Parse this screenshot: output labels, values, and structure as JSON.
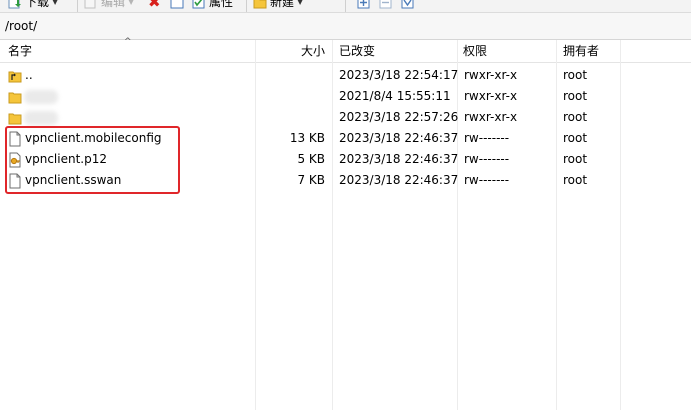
{
  "toolbar": {
    "download_label": "下载",
    "edit_label": "编辑",
    "properties_label": "属性",
    "new_label": "新建"
  },
  "path": "/root/",
  "columns": {
    "name": "名字",
    "size": "大小",
    "modified": "已改变",
    "permissions": "权限",
    "owner": "拥有者"
  },
  "files": [
    {
      "name": "..",
      "size": "",
      "modified": "2023/3/18 22:54:17",
      "permissions": "rwxr-xr-x",
      "owner": "root",
      "icon": "parent-folder-icon"
    },
    {
      "name": "",
      "size": "",
      "modified": "2021/8/4 15:55:11",
      "permissions": "rwxr-xr-x",
      "owner": "root",
      "icon": "folder-icon"
    },
    {
      "name": "",
      "size": "",
      "modified": "2023/3/18 22:57:26",
      "permissions": "rwxr-xr-x",
      "owner": "root",
      "icon": "folder-icon"
    },
    {
      "name": "vpnclient.mobileconfig",
      "size": "13 KB",
      "modified": "2023/3/18 22:46:37",
      "permissions": "rw-------",
      "owner": "root",
      "icon": "file-icon"
    },
    {
      "name": "vpnclient.p12",
      "size": "5 KB",
      "modified": "2023/3/18 22:46:37",
      "permissions": "rw-------",
      "owner": "root",
      "icon": "certificate-file-icon"
    },
    {
      "name": "vpnclient.sswan",
      "size": "7 KB",
      "modified": "2023/3/18 22:46:37",
      "permissions": "rw-------",
      "owner": "root",
      "icon": "file-icon"
    }
  ],
  "colors": {
    "highlight": "#e0262a",
    "folder": "#f5c53b"
  }
}
